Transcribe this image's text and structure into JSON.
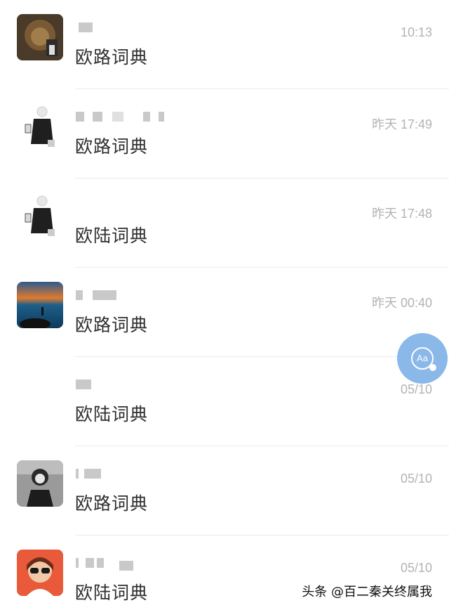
{
  "chats": [
    {
      "message": "欧路词典",
      "time": "10:13"
    },
    {
      "message": "欧路词典",
      "time": "昨天 17:49"
    },
    {
      "message": "欧陆词典",
      "time": "昨天 17:48"
    },
    {
      "message": "欧路词典",
      "time": "昨天 00:40"
    },
    {
      "message": "欧陆词典",
      "time": "05/10"
    },
    {
      "message": "欧路词典",
      "time": "05/10"
    },
    {
      "message": "欧陆词典",
      "time": "05/10"
    }
  ],
  "floating_button": {
    "label": "Aa",
    "icon": "translate-aa-icon"
  },
  "watermark": "头条 @百二秦关终属我",
  "colors": {
    "accent": "#7fb2e8",
    "text": "#2e2e2e",
    "time": "#b3b3b3"
  }
}
